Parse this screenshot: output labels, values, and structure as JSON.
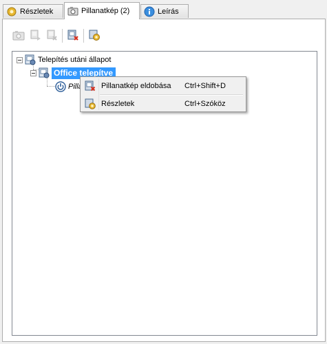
{
  "tabs": [
    {
      "label": "Részletek",
      "icon": "gear-icon"
    },
    {
      "label": "Pillanatkép (2)",
      "icon": "camera-icon"
    },
    {
      "label": "Leírás",
      "icon": "info-icon"
    }
  ],
  "toolbar": {
    "buttons": [
      "camera-icon",
      "computer-icon",
      "computer-remove-icon",
      "snapshot-delete-icon",
      "details-gear-icon"
    ]
  },
  "tree": {
    "root": {
      "label": "Telepítés utáni állapot"
    },
    "child": {
      "label": "Office telepítve"
    },
    "grandchild": {
      "label": "Pilla"
    }
  },
  "context_menu": {
    "items": [
      {
        "label": "Pillanatkép eldobása",
        "shortcut": "Ctrl+Shift+D",
        "icon": "snapshot-delete-icon"
      },
      {
        "label": "Részletek",
        "shortcut": "Ctrl+Szóköz",
        "icon": "details-gear-icon"
      }
    ]
  }
}
